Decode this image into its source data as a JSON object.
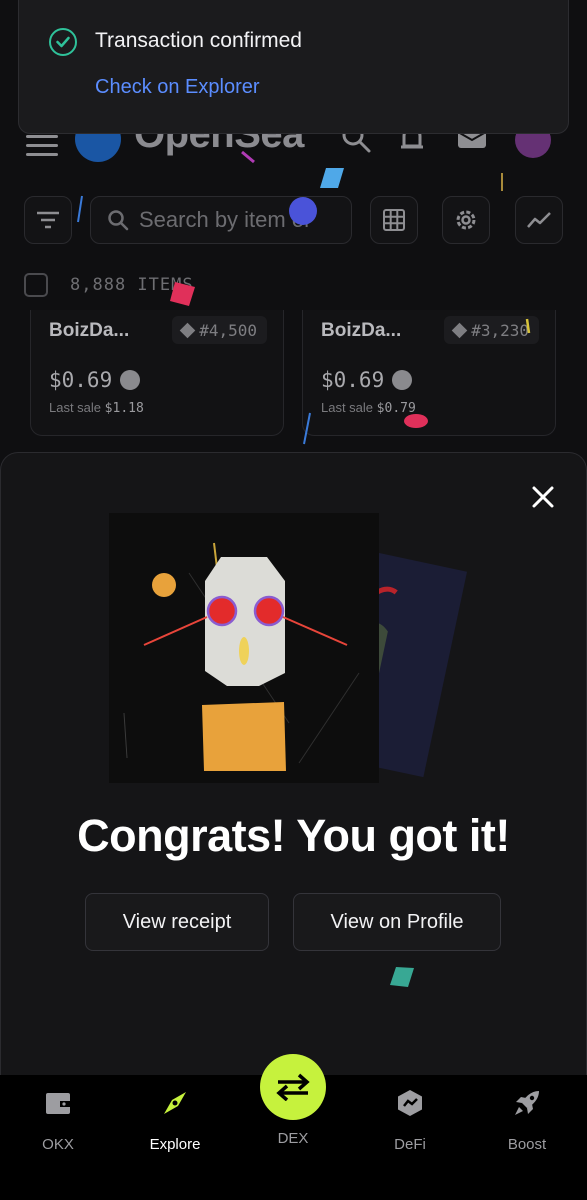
{
  "toast": {
    "message": "Transaction confirmed",
    "link_label": "Check on Explorer",
    "accent": "#2fc29a",
    "link_color": "#5b8dff"
  },
  "header": {
    "logo_text": "OpenSea",
    "icons": [
      "menu-icon",
      "search-icon",
      "bell-icon",
      "mail-icon",
      "avatar"
    ]
  },
  "toolbar": {
    "search_placeholder": "Search by item or",
    "icons": [
      "filter-icon",
      "grid-icon",
      "gear-icon",
      "trend-icon"
    ]
  },
  "collection": {
    "item_count": "8,888 ITEMS"
  },
  "cards": [
    {
      "name": "BoizDa...",
      "token": "#4,500",
      "price": "$0.69",
      "last_sale_label": "Last sale",
      "last_sale": "$1.18"
    },
    {
      "name": "BoizDa...",
      "token": "#3,230",
      "price": "$0.69",
      "last_sale_label": "Last sale",
      "last_sale": "$0.79"
    }
  ],
  "modal": {
    "headline": "Congrats! You got it!",
    "receipt_label": "View receipt",
    "profile_label": "View on Profile"
  },
  "bottom_nav": {
    "items": [
      {
        "label": "OKX",
        "icon": "wallet-icon"
      },
      {
        "label": "Explore",
        "icon": "compass-icon",
        "active": true
      },
      {
        "label": "DEX",
        "icon": "swap-icon"
      },
      {
        "label": "DeFi",
        "icon": "defi-icon"
      },
      {
        "label": "Boost",
        "icon": "rocket-icon"
      }
    ],
    "dex_color": "#c6f23d"
  }
}
